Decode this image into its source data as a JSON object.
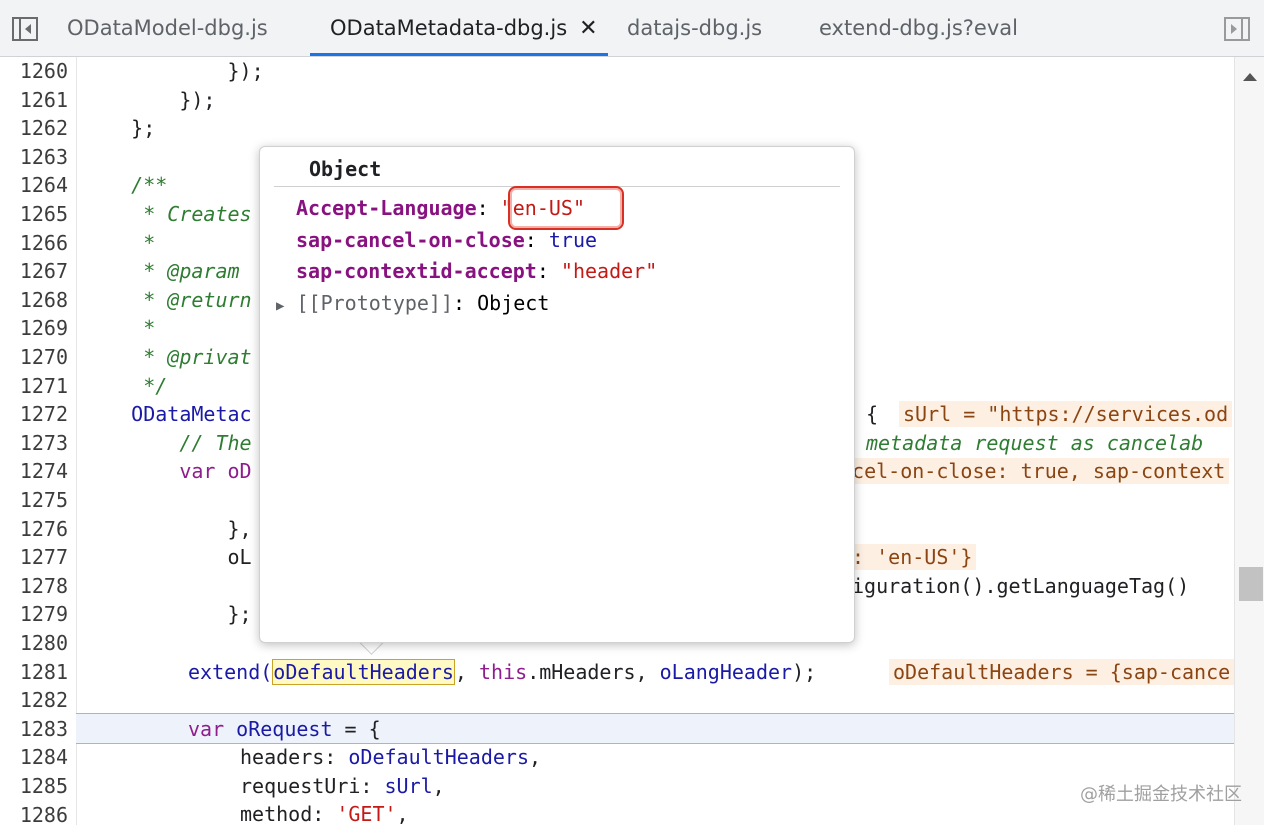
{
  "tabs": [
    {
      "label": "ODataModel-dbg.js",
      "active": false
    },
    {
      "label": "ODataMetadata-dbg.js",
      "active": true,
      "close": "✕"
    },
    {
      "label": "datajs-dbg.js",
      "active": false
    },
    {
      "label": "extend-dbg.js?eval",
      "active": false
    }
  ],
  "lines": [
    {
      "n": "1260",
      "code": "            });"
    },
    {
      "n": "1261",
      "code": "        });"
    },
    {
      "n": "1262",
      "code": "    };"
    },
    {
      "n": "1263",
      "code": ""
    },
    {
      "n": "1264",
      "code": "    /**"
    },
    {
      "n": "1265",
      "code": "     * Creates"
    },
    {
      "n": "1266",
      "code": "     *"
    },
    {
      "n": "1267",
      "code": "     * @param"
    },
    {
      "n": "1268",
      "code": "     * @return"
    },
    {
      "n": "1269",
      "code": "     *"
    },
    {
      "n": "1270",
      "code": "     * @privat"
    },
    {
      "n": "1271",
      "code": "     */"
    },
    {
      "n": "1272",
      "code": "    ODataMetac"
    },
    {
      "n": "1273",
      "code": "        // The"
    },
    {
      "n": "1274",
      "code": "        var oD"
    },
    {
      "n": "1275",
      "code": ""
    },
    {
      "n": "1276",
      "code": "            },"
    },
    {
      "n": "1277",
      "code": "            oL"
    },
    {
      "n": "1278",
      "code": ""
    },
    {
      "n": "1279",
      "code": "            };"
    },
    {
      "n": "1280",
      "code": ""
    },
    {
      "n": "1281",
      "code": ""
    },
    {
      "n": "1282",
      "code": ""
    },
    {
      "n": "1283",
      "code": ""
    },
    {
      "n": "1284",
      "code": ""
    },
    {
      "n": "1285",
      "code": ""
    },
    {
      "n": "1286",
      "code": ""
    }
  ],
  "right_frags": {
    "l1272_brace": "{",
    "l1272_inline": "sUrl = \"https://services.od",
    "l1273": "metadata request as cancelab",
    "l1274": "ncel-on-close: true, sap-context",
    "l1277": "e: 'en-US'}",
    "l1278": "iguration().getLanguageTag()"
  },
  "code_1281": {
    "fn": "extend(",
    "arg1": "oDefaultHeaders",
    "sep": ", ",
    "this": "this",
    "rest": ".mHeaders, ",
    "arg3": "oLangHeader",
    "end": ");",
    "inline": "oDefaultHeaders = {sap-cance"
  },
  "code_1283": {
    "kw": "var",
    "name": "oRequest",
    "rest": " = {"
  },
  "code_1284": {
    "key": "headers: ",
    "val": "oDefaultHeaders",
    "end": ","
  },
  "code_1285": {
    "key": "requestUri: ",
    "val": "sUrl",
    "end": ","
  },
  "code_1286": {
    "key": "method: ",
    "val": "'GET'",
    "end": ","
  },
  "popup": {
    "title": "Object",
    "props": [
      {
        "key": "Accept-Language",
        "value": "\"en-US\"",
        "type": "string"
      },
      {
        "key": "sap-cancel-on-close",
        "value": "true",
        "type": "bool"
      },
      {
        "key": "sap-contextid-accept",
        "value": "\"header\"",
        "type": "string"
      }
    ],
    "proto_label": "[[Prototype]]",
    "proto_value": "Object"
  },
  "watermark": "@稀土掘金技术社区",
  "colors": {
    "accent": "#1a73e8",
    "highlight_border": "#d93025"
  }
}
